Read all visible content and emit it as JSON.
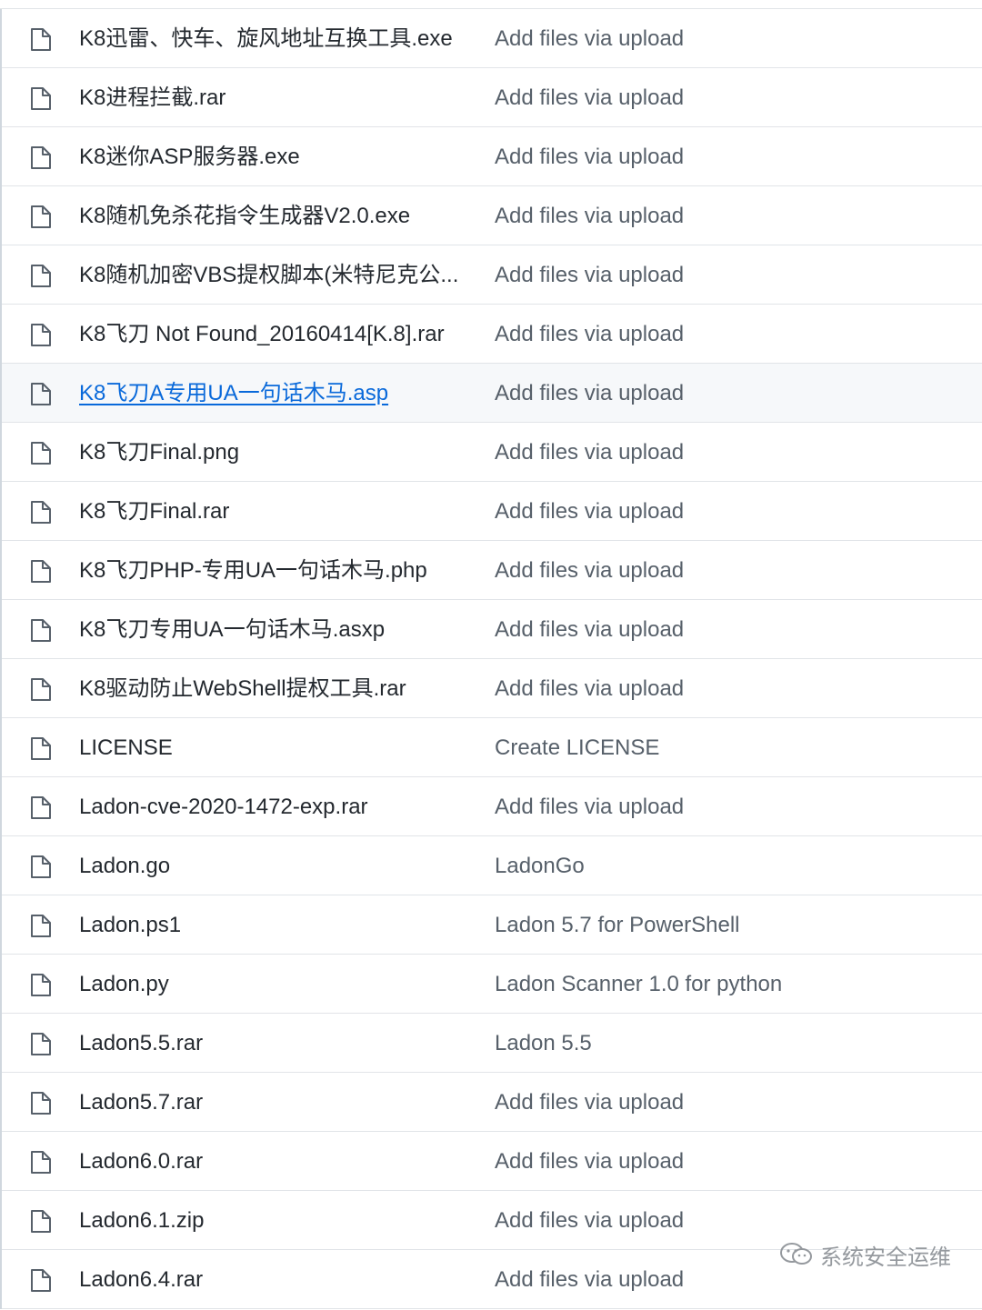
{
  "files": [
    {
      "name": "K8迅雷、快车、旋风地址互换工具.exe",
      "message": "Add files via upload"
    },
    {
      "name": "K8进程拦截.rar",
      "message": "Add files via upload"
    },
    {
      "name": "K8迷你ASP服务器.exe",
      "message": "Add files via upload"
    },
    {
      "name": "K8随机免杀花指令生成器V2.0.exe",
      "message": "Add files via upload"
    },
    {
      "name": "K8随机加密VBS提权脚本(米特尼克公...",
      "message": "Add files via upload"
    },
    {
      "name": "K8飞刀 Not Found_20160414[K.8].rar",
      "message": "Add files via upload"
    },
    {
      "name": "K8飞刀A专用UA一句话木马.asp",
      "message": "Add files via upload",
      "hovered": true
    },
    {
      "name": "K8飞刀Final.png",
      "message": "Add files via upload"
    },
    {
      "name": "K8飞刀Final.rar",
      "message": "Add files via upload"
    },
    {
      "name": "K8飞刀PHP-专用UA一句话木马.php",
      "message": "Add files via upload"
    },
    {
      "name": "K8飞刀专用UA一句话木马.asxp",
      "message": "Add files via upload"
    },
    {
      "name": "K8驱动防止WebShell提权工具.rar",
      "message": "Add files via upload"
    },
    {
      "name": "LICENSE",
      "message": "Create LICENSE"
    },
    {
      "name": "Ladon-cve-2020-1472-exp.rar",
      "message": "Add files via upload"
    },
    {
      "name": "Ladon.go",
      "message": "LadonGo"
    },
    {
      "name": "Ladon.ps1",
      "message": "Ladon 5.7 for PowerShell"
    },
    {
      "name": "Ladon.py",
      "message": "Ladon Scanner 1.0 for python"
    },
    {
      "name": "Ladon5.5.rar",
      "message": "Ladon 5.5"
    },
    {
      "name": "Ladon5.7.rar",
      "message": "Add files via upload"
    },
    {
      "name": "Ladon6.0.rar",
      "message": "Add files via upload"
    },
    {
      "name": "Ladon6.1.zip",
      "message": "Add files via upload"
    },
    {
      "name": "Ladon6.4.rar",
      "message": "Add files via upload"
    }
  ],
  "icons": {
    "file": "file-icon",
    "watermark": "wechat-icon"
  },
  "colors": {
    "link": "#0969da",
    "text": "#24292f",
    "muted": "#57606a",
    "border": "#e1e4e8",
    "hover_bg": "#f6f8fa"
  },
  "watermark": {
    "text": "系统安全运维"
  }
}
